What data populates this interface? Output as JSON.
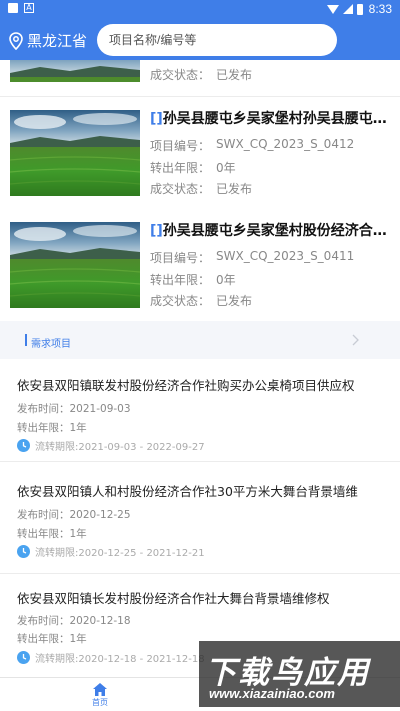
{
  "status_bar": {
    "time": "8:33"
  },
  "header": {
    "location": "黑龙江省",
    "search_placeholder": "项目名称/编号等",
    "color": "#3f7ee8"
  },
  "partial_card": {
    "status_label": "成交状态：",
    "status_value": "已发布"
  },
  "projects": [
    {
      "bracket": "[]",
      "title": "孙吴县腰屯乡吴家堡村孙吴县腰屯乡吴家堡村",
      "code_label": "项目编号：",
      "code_value": "SWX_CQ_2023_S_0412",
      "term_label": "转出年限：",
      "term_value": "0年",
      "status_label": "成交状态：",
      "status_value": "已发布"
    },
    {
      "bracket": "[]",
      "title": "孙吴县腰屯乡吴家堡村股份经济合作社",
      "code_label": "项目编号：",
      "code_value": "SWX_CQ_2023_S_0411",
      "term_label": "转出年限：",
      "term_value": "0年",
      "status_label": "成交状态：",
      "status_value": "已发布"
    }
  ],
  "demand_section": {
    "title": "需求项目"
  },
  "demands": [
    {
      "title": "依安县双阳镇联发村股份经济合作社购买办公桌椅项目供应权",
      "publish": "发布时间：2021-09-03",
      "term": "转出年限：1年",
      "period": "流转期限:2021-09-03 - 2022-09-27"
    },
    {
      "title": "依安县双阳镇人和村股份经济合作社30平方米大舞台背景墙维",
      "publish": "发布时间：2020-12-25",
      "term": "转出年限：1年",
      "period": "流转期限:2020-12-25 - 2021-12-21"
    },
    {
      "title": "依安县双阳镇长发村股份经济合作社大舞台背景墙维修权",
      "publish": "发布时间：2020-12-18",
      "term": "转出年限：1年",
      "period": "流转期限:2020-12-18 - 2021-12-18"
    }
  ],
  "bottom_nav": {
    "home_label": "首页"
  },
  "watermark": {
    "main": "下载鸟应用",
    "sub": "www.xiazainiao.com"
  }
}
